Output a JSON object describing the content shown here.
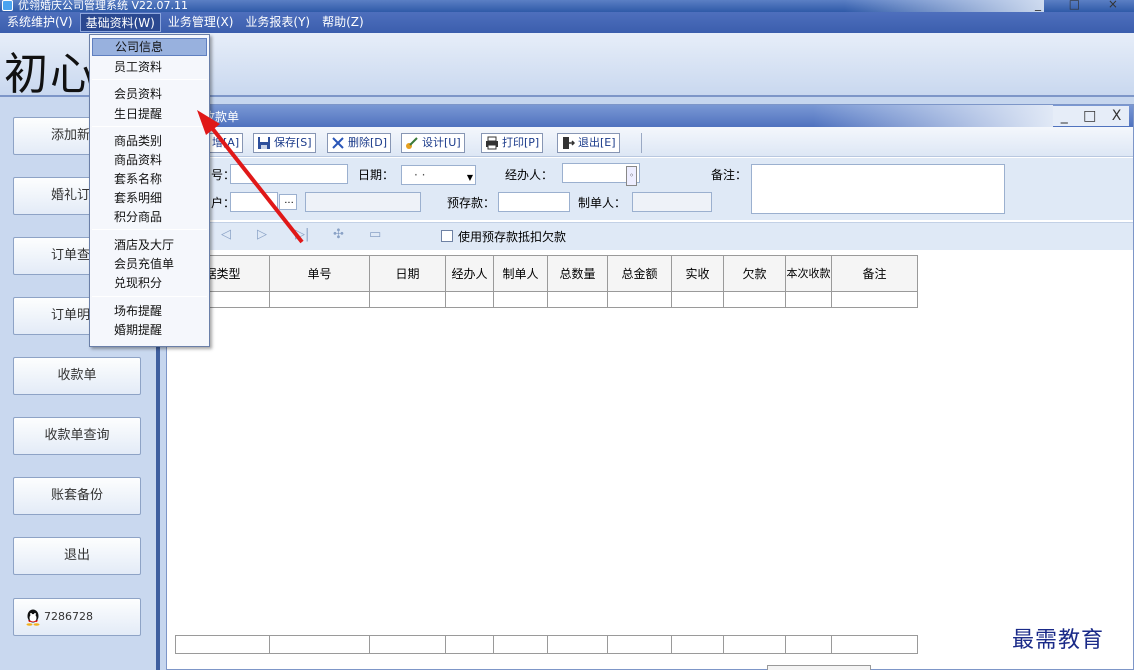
{
  "titlebar": {
    "title": "优翎婚庆公司管理系统 V22.07.11",
    "controls": "_ □ ×"
  },
  "menubar": [
    {
      "label": "系统维护(V)"
    },
    {
      "label": "基础资料(W)",
      "active": true
    },
    {
      "label": "业务管理(X)"
    },
    {
      "label": "业务报表(Y)"
    },
    {
      "label": "帮助(Z)"
    }
  ],
  "logo": "初心",
  "nav": [
    {
      "label": "添加新客"
    },
    {
      "label": "婚礼订单"
    },
    {
      "label": "订单查询"
    },
    {
      "label": "订单明细"
    },
    {
      "label": "收款单"
    },
    {
      "label": "收款单查询"
    },
    {
      "label": "账套备份"
    },
    {
      "label": "退出"
    },
    {
      "label": "7286728"
    }
  ],
  "child_window": {
    "title": "收款单",
    "controls": {
      "minimize": "_",
      "maximize": "□",
      "close": "X"
    },
    "toolbar": {
      "add": "增[A]",
      "save": "保存[S]",
      "delete": "删除[D]",
      "design": "设计[U]",
      "print": "打印[P]",
      "exit": "退出[E]"
    },
    "form": {
      "number_label": "号：",
      "date_label": "日期：",
      "date_value": "· ·",
      "handler_label": "经办人：",
      "remark_label": "备注：",
      "customer_label": "户：",
      "browse": "...",
      "deposit_label": "预存款：",
      "creator_label": "制单人："
    },
    "use_deposit_label": "使用预存款抵扣欠款",
    "grid": {
      "columns": [
        "据类型",
        "单号",
        "日期",
        "经办人",
        "制单人",
        "总数量",
        "总金额",
        "实收",
        "欠款",
        "本次收款",
        "备注"
      ]
    }
  },
  "dropdown": {
    "items": [
      {
        "label": "公司信息",
        "hover": true
      },
      {
        "label": "员工资料"
      },
      {
        "label": "会员资料"
      },
      {
        "label": "生日提醒"
      },
      {
        "label": "商品类别"
      },
      {
        "label": "商品资料"
      },
      {
        "label": "套系名称"
      },
      {
        "label": "套系明细"
      },
      {
        "label": "积分商品"
      },
      {
        "label": "酒店及大厅"
      },
      {
        "label": "会员充值单"
      },
      {
        "label": "兑现积分"
      },
      {
        "label": "场布提醒"
      },
      {
        "label": "婚期提醒"
      }
    ]
  },
  "watermark": "最需教育",
  "colors": {
    "arrow": "#e01818",
    "menubar": "#3b5ead",
    "accent": "#98b1de"
  }
}
